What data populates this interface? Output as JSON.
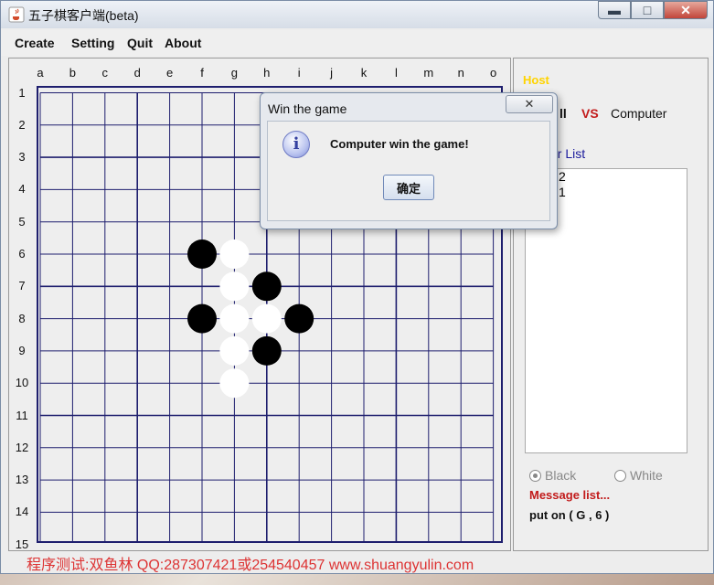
{
  "window": {
    "title": "五子棋客户端(beta)",
    "controls": {
      "minimize": "▬",
      "maximize": "□",
      "close": "✕"
    }
  },
  "menu": [
    "Create",
    "Setting",
    "Quit",
    "About"
  ],
  "board": {
    "columns": [
      "a",
      "b",
      "c",
      "d",
      "e",
      "f",
      "g",
      "h",
      "i",
      "j",
      "k",
      "l",
      "m",
      "n",
      "o"
    ],
    "rows": [
      "1",
      "2",
      "3",
      "4",
      "5",
      "6",
      "7",
      "8",
      "9",
      "10",
      "11",
      "12",
      "13",
      "14",
      "15"
    ],
    "line_color": "#1e1e6e",
    "stones": [
      {
        "col": "f",
        "row": 6,
        "color": "black"
      },
      {
        "col": "g",
        "row": 6,
        "color": "white"
      },
      {
        "col": "g",
        "row": 7,
        "color": "white"
      },
      {
        "col": "h",
        "row": 7,
        "color": "black"
      },
      {
        "col": "f",
        "row": 8,
        "color": "black"
      },
      {
        "col": "g",
        "row": 8,
        "color": "white"
      },
      {
        "col": "h",
        "row": 8,
        "color": "white"
      },
      {
        "col": "i",
        "row": 8,
        "color": "black"
      },
      {
        "col": "g",
        "row": 9,
        "color": "white"
      },
      {
        "col": "h",
        "row": 9,
        "color": "black"
      },
      {
        "col": "g",
        "row": 10,
        "color": "white"
      }
    ]
  },
  "side": {
    "host_label": "Host",
    "player_left": "ll",
    "vs": "VS",
    "player_right": "Computer",
    "player_list_label": "er List",
    "player_list": [
      "2",
      "1"
    ],
    "radio_black": "Black",
    "radio_white": "White",
    "message_label": "Message list...",
    "message_text": "put on ( G , 6 )"
  },
  "footer": "程序测试:双鱼林 QQ:287307421或254540457 www.shuangyulin.com",
  "dialog": {
    "title": "Win the game",
    "close": "✕",
    "message": "Computer win the game!",
    "ok": "确定"
  }
}
